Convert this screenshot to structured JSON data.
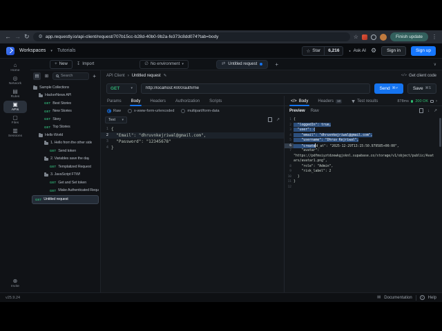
{
  "browser": {
    "url": "app.requestly.io/api-client/request/707b15cc-b28d-40b0-9b2a-fe373c8dd074?tab=body",
    "update_button": "Finish update"
  },
  "header": {
    "workspaces": "Workspaces",
    "tutorials": "Tutorials",
    "star_label": "Star",
    "star_count": "6,216",
    "ask_ai": "Ask AI",
    "sign_in": "Sign in",
    "sign_up": "Sign up"
  },
  "toolbar": {
    "new": "New",
    "import": "Import",
    "environment": "No environment",
    "tab": "Untitled request"
  },
  "rail": {
    "items": [
      {
        "label": "Home",
        "icon": "home",
        "active": false
      },
      {
        "label": "Network",
        "icon": "network",
        "active": false
      },
      {
        "label": "Rules",
        "icon": "rules",
        "active": false
      },
      {
        "label": "APIs",
        "icon": "apis",
        "active": true
      },
      {
        "label": "Files",
        "icon": "files",
        "active": false
      },
      {
        "label": "Sessions",
        "icon": "sessions",
        "active": false
      }
    ],
    "invite": "Invite",
    "version": "v25.9.24"
  },
  "sidebar": {
    "search_placeholder": "Search",
    "tree": [
      {
        "kind": "folder",
        "label": "Sample Collections",
        "depth": 0
      },
      {
        "kind": "folder",
        "label": "HackerNews API",
        "depth": 1
      },
      {
        "kind": "request",
        "method": "GET",
        "label": "Best Stories",
        "depth": 2
      },
      {
        "kind": "request",
        "method": "GET",
        "label": "New Stories",
        "depth": 2
      },
      {
        "kind": "request",
        "method": "GET",
        "label": "Story",
        "depth": 2
      },
      {
        "kind": "request",
        "method": "GET",
        "label": "Top Stories",
        "depth": 2
      },
      {
        "kind": "folder",
        "label": "Hello World",
        "depth": 1
      },
      {
        "kind": "folder",
        "label": "1. Hello from the other side",
        "depth": 2
      },
      {
        "kind": "request",
        "method": "GET",
        "label": "Send token",
        "depth": 3
      },
      {
        "kind": "folder",
        "label": "2. Variables save the day",
        "depth": 2
      },
      {
        "kind": "request",
        "method": "GET",
        "label": "Templatized Request",
        "depth": 3
      },
      {
        "kind": "folder",
        "label": "3. JavaScript FTW!",
        "depth": 2
      },
      {
        "kind": "request",
        "method": "GET",
        "label": "Get and Set token",
        "depth": 3
      },
      {
        "kind": "request",
        "method": "GET",
        "label": "Make Authenticated Request",
        "depth": 3
      },
      {
        "kind": "request",
        "method": "GET",
        "label": "Untitled request",
        "depth": 0,
        "selected": true
      }
    ]
  },
  "request": {
    "breadcrumb": [
      "API Client",
      "Untitled request"
    ],
    "method": "GET",
    "url": "http://localhost:4000/auth/me",
    "get_client_code": "Get client code",
    "send": "Send",
    "send_shortcut": "⌘↵",
    "save": "Save",
    "save_shortcut": "⌘S",
    "tabs": [
      "Params",
      "Body",
      "Headers",
      "Authorization",
      "Scripts"
    ],
    "active_tab": "Body",
    "body_modes": [
      "Raw",
      "x-www-form-urlencoded",
      "multipart/form-data"
    ],
    "selected_mode": "Raw",
    "content_type": "Text",
    "body_lines": [
      {
        "n": "1",
        "t": "{"
      },
      {
        "n": "2",
        "t": "  \"Email\": \"dhruvnkejriwal@gmail.com\",",
        "active": true
      },
      {
        "n": "3",
        "t": "  \"Password\": \"12345678\""
      },
      {
        "n": "4",
        "t": "}"
      }
    ]
  },
  "response": {
    "tabs": [
      {
        "label": "Body",
        "icon": "code",
        "active": true
      },
      {
        "label": "Headers",
        "badge": "10",
        "active": false
      },
      {
        "label": "Test results",
        "icon": "flask",
        "active": false
      }
    ],
    "time": "878ms",
    "status": "200 OK",
    "views": [
      "Preview",
      "Raw"
    ],
    "active_view": "Preview",
    "body_rows": [
      {
        "n": "1",
        "t": "{"
      },
      {
        "n": "2",
        "t": "  \"loggedIn\": true,",
        "sel": true
      },
      {
        "n": "3",
        "t": "  \"user\": {",
        "sel": true
      },
      {
        "n": "4",
        "t": "    \"email\": \"dhruvnkejriwal@gmail.com\",",
        "sel": true
      },
      {
        "n": "5",
        "t": "    \"username\": \"Dhruv Kejriwal\",",
        "sel": true
      },
      {
        "n": "6",
        "t": "    \"created_at\": \"2025-12-29T13:15:50.979585+00:00\",",
        "active": true,
        "selpart": "    \"create"
      },
      {
        "n": "7",
        "t": "    \"avatar\":"
      },
      {
        "n": "",
        "t": "\"https://pdfmsiyztdzewkgjxknl.supabase.co/storage/v1/object/public/Avat"
      },
      {
        "n": "",
        "t": "ars/avatar1.png\","
      },
      {
        "n": "8",
        "t": "    \"role\": \"Admin\","
      },
      {
        "n": "9",
        "t": "    \"risk_label\": 2"
      },
      {
        "n": "10",
        "t": "  }"
      },
      {
        "n": "11",
        "t": "}"
      },
      {
        "n": "12",
        "t": ""
      }
    ]
  },
  "footer": {
    "documentation": "Documentation",
    "help": "Help"
  }
}
